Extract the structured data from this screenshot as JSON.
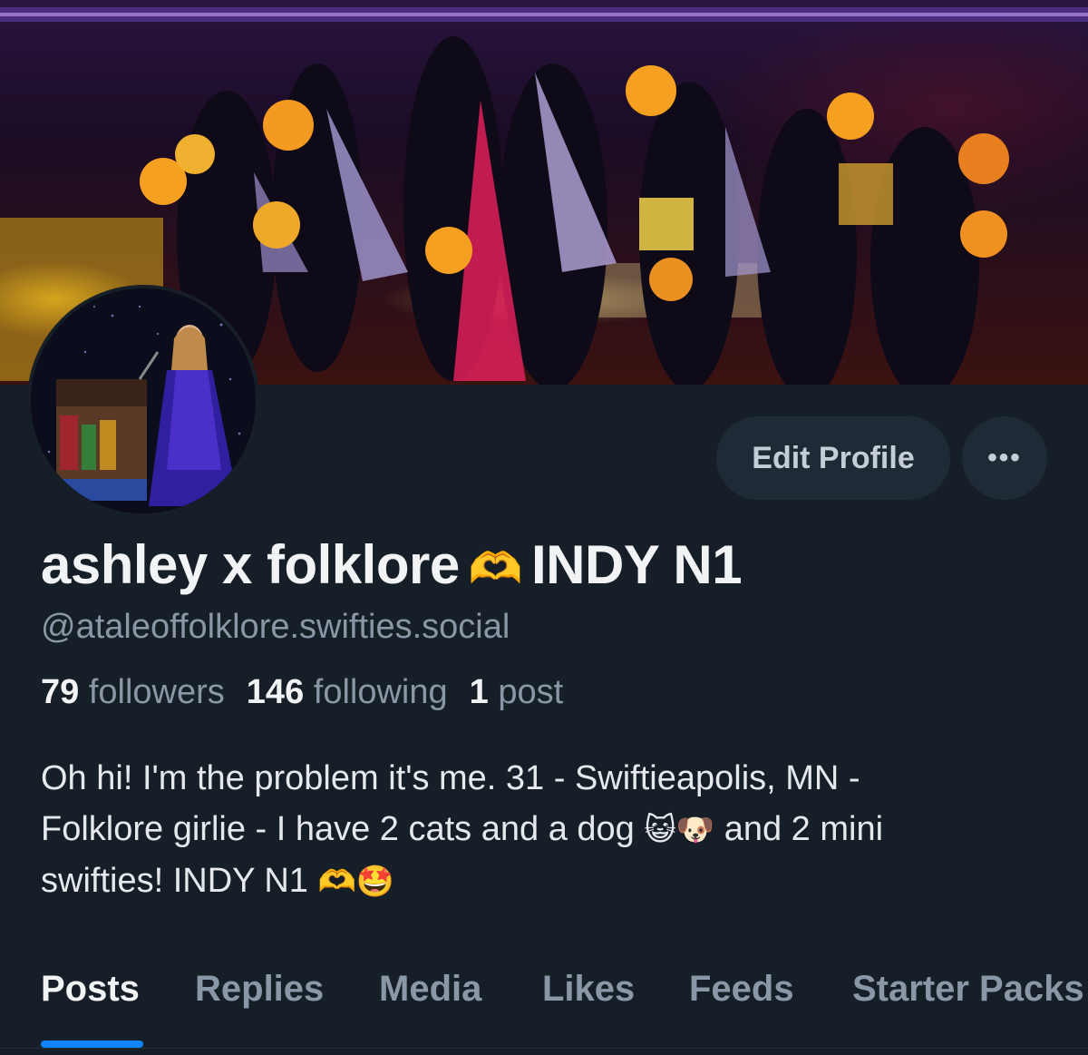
{
  "profile": {
    "display_name_part1": "ashley x folklore",
    "display_name_emoji": "🫶",
    "display_name_part2": "INDY N1",
    "handle": "@ataleoffolklore.swifties.social",
    "followers_count": "79",
    "followers_label": "followers",
    "following_count": "146",
    "following_label": "following",
    "posts_count": "1",
    "posts_label": "post",
    "bio_line1": "Oh hi! I'm the problem it's me. 31 - Swiftieapolis, MN -",
    "bio_line2_text": "Folklore girlie - I have 2 cats and a dog",
    "bio_emoji_cat": "😺",
    "bio_emoji_dog": "🐶",
    "bio_line2_end": "and 2 mini",
    "bio_line3_text": "swifties! INDY N1",
    "bio_emoji_heart_hands": "🫶",
    "bio_emoji_star_struck": "🤩"
  },
  "actions": {
    "edit_profile_label": "Edit Profile",
    "more_label": "•••"
  },
  "tabs": [
    {
      "label": "Posts",
      "active": true
    },
    {
      "label": "Replies",
      "active": false
    },
    {
      "label": "Media",
      "active": false
    },
    {
      "label": "Likes",
      "active": false
    },
    {
      "label": "Feeds",
      "active": false
    },
    {
      "label": "Starter Packs",
      "active": false
    }
  ],
  "colors": {
    "background": "#161e27",
    "accent": "#1083fe",
    "muted_text": "#8a97a6",
    "button_bg": "#1e2a36"
  }
}
